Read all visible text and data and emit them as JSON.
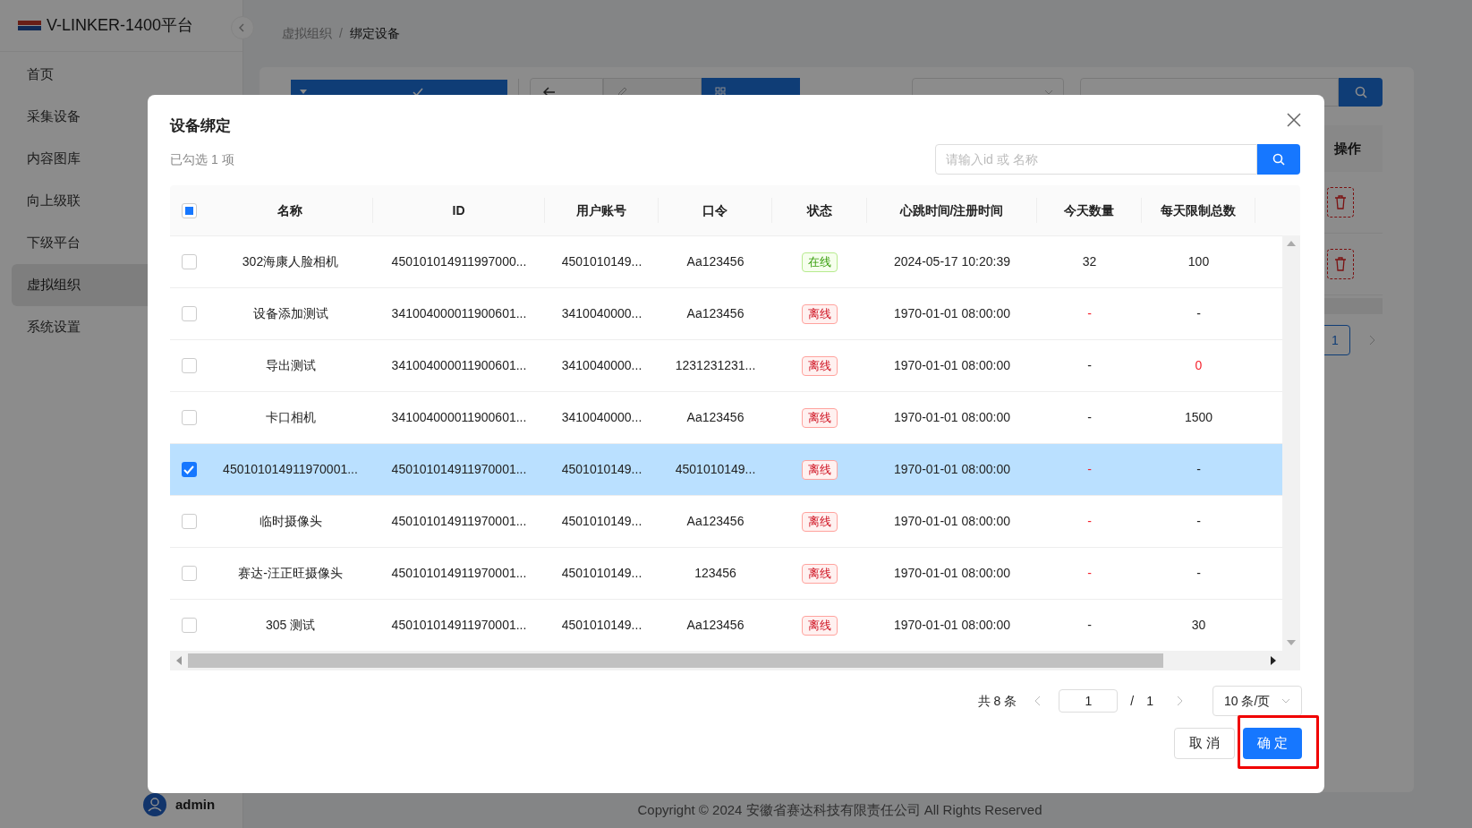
{
  "sidebar": {
    "logo_text": "V-LINKER-1400平台",
    "items": [
      {
        "label": "首页",
        "selected": false
      },
      {
        "label": "采集设备",
        "selected": false
      },
      {
        "label": "内容图库",
        "selected": false
      },
      {
        "label": "向上级联",
        "selected": false
      },
      {
        "label": "下级平台",
        "selected": false
      },
      {
        "label": "虚拟组织",
        "selected": true
      },
      {
        "label": "系统设置",
        "selected": false
      }
    ],
    "user": {
      "name": "admin"
    }
  },
  "breadcrumb": {
    "separator": "/",
    "items": [
      {
        "label": "虚拟组织",
        "current": false
      },
      {
        "label": "绑定设备",
        "current": true
      }
    ]
  },
  "toolbar": {
    "include_children": {
      "checked": true
    },
    "buttons": [
      {
        "kind": "back",
        "selected": false
      },
      {
        "kind": "edit",
        "selected": false
      },
      {
        "kind": "all",
        "selected": true
      }
    ]
  },
  "page_table": {
    "columns": [
      "操作"
    ],
    "rows": [
      {
        "kind": "delete"
      },
      {
        "kind": "delete"
      }
    ],
    "pagination": {
      "current": "1"
    }
  },
  "footer": "Copyright © 2024 安徽省赛达科技有限责任公司 All Rights Reserved",
  "modal": {
    "title": "设备绑定",
    "selected_info": "已勾选 1 项",
    "search": {
      "placeholder": "请输入id 或 名称"
    },
    "select_all": {
      "checked": false,
      "indeterminate": true
    },
    "columns": [
      "名称",
      "ID",
      "用户账号",
      "口令",
      "状态",
      "心跳时间/注册时间",
      "今天数量",
      "每天限制总数"
    ],
    "rows": [
      {
        "selected": false,
        "name": "302海康人脸相机",
        "id": "450101014911997000...",
        "account": "4501010149...",
        "password": "Aa123456",
        "status": {
          "text": "在线",
          "kind": "online"
        },
        "time": "2024-05-17 10:20:39",
        "today": {
          "text": "32",
          "alert": false
        },
        "limit": {
          "text": "100",
          "alert": false
        }
      },
      {
        "selected": false,
        "name": "设备添加测试",
        "id": "341004000011900601...",
        "account": "3410040000...",
        "password": "Aa123456",
        "status": {
          "text": "离线",
          "kind": "offline"
        },
        "time": "1970-01-01 08:00:00",
        "today": {
          "text": "-",
          "alert": true
        },
        "limit": {
          "text": "-",
          "alert": false
        }
      },
      {
        "selected": false,
        "name": "导出测试",
        "id": "341004000011900601...",
        "account": "3410040000...",
        "password": "1231231231...",
        "status": {
          "text": "离线",
          "kind": "offline"
        },
        "time": "1970-01-01 08:00:00",
        "today": {
          "text": "-",
          "alert": false
        },
        "limit": {
          "text": "0",
          "alert": true
        }
      },
      {
        "selected": false,
        "name": "卡口相机",
        "id": "341004000011900601...",
        "account": "3410040000...",
        "password": "Aa123456",
        "status": {
          "text": "离线",
          "kind": "offline"
        },
        "time": "1970-01-01 08:00:00",
        "today": {
          "text": "-",
          "alert": false
        },
        "limit": {
          "text": "1500",
          "alert": false
        }
      },
      {
        "selected": true,
        "name": "450101014911970001...",
        "id": "450101014911970001...",
        "account": "4501010149...",
        "password": "4501010149...",
        "status": {
          "text": "离线",
          "kind": "offline"
        },
        "time": "1970-01-01 08:00:00",
        "today": {
          "text": "-",
          "alert": true
        },
        "limit": {
          "text": "-",
          "alert": false
        }
      },
      {
        "selected": false,
        "name": "临时摄像头",
        "id": "450101014911970001...",
        "account": "4501010149...",
        "password": "Aa123456",
        "status": {
          "text": "离线",
          "kind": "offline"
        },
        "time": "1970-01-01 08:00:00",
        "today": {
          "text": "-",
          "alert": true
        },
        "limit": {
          "text": "-",
          "alert": false
        }
      },
      {
        "selected": false,
        "name": "赛达-汪正旺摄像头",
        "id": "450101014911970001...",
        "account": "4501010149...",
        "password": "123456",
        "status": {
          "text": "离线",
          "kind": "offline"
        },
        "time": "1970-01-01 08:00:00",
        "today": {
          "text": "-",
          "alert": true
        },
        "limit": {
          "text": "-",
          "alert": false
        }
      },
      {
        "selected": false,
        "name": "305 测试",
        "id": "450101014911970001...",
        "account": "4501010149...",
        "password": "Aa123456",
        "status": {
          "text": "离线",
          "kind": "offline"
        },
        "time": "1970-01-01 08:00:00",
        "today": {
          "text": "-",
          "alert": false
        },
        "limit": {
          "text": "30",
          "alert": false
        }
      }
    ],
    "pagination": {
      "total": "共 8 条",
      "page": "1",
      "separator": "/",
      "pages": "1",
      "page_size": "10 条/页"
    },
    "buttons": [
      {
        "label": "取 消",
        "kind": "cancel",
        "highlighted": false
      },
      {
        "label": "确 定",
        "kind": "primary",
        "highlighted": true
      }
    ]
  }
}
